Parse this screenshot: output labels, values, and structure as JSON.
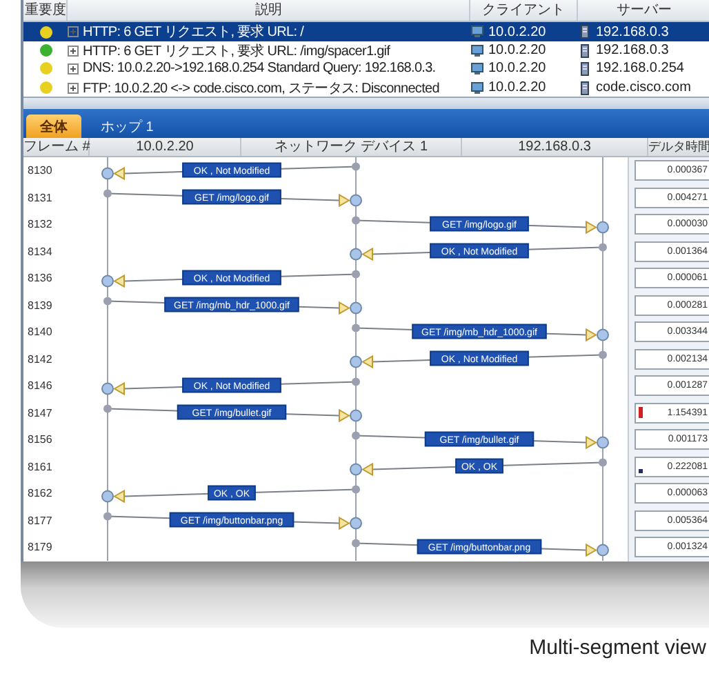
{
  "event_table": {
    "columns": [
      "重要度",
      "説明",
      "クライアント",
      "サーバー"
    ],
    "rows": [
      {
        "color": "#e8d020",
        "selected": true,
        "description": "HTTP: 6 GET リクエスト, 要求 URL: /",
        "client": "10.0.2.20",
        "server": "192.168.0.3"
      },
      {
        "color": "#3cb030",
        "selected": false,
        "description": "HTTP: 6 GET リクエスト, 要求 URL: /img/spacer1.gif",
        "client": "10.0.2.20",
        "server": "192.168.0.3"
      },
      {
        "color": "#e8d020",
        "selected": false,
        "description": "DNS: 10.0.2.20->192.168.0.254 Standard Query: 192.168.0.3.",
        "client": "10.0.2.20",
        "server": "192.168.0.254"
      },
      {
        "color": "#e8d020",
        "selected": false,
        "description": "FTP: 10.0.2.20 <-> code.cisco.com, ステータス: Disconnected",
        "client": "10.0.2.20",
        "server": "code.cisco.com"
      }
    ]
  },
  "tabs": [
    {
      "label": "全体",
      "selected": true
    },
    {
      "label": "ホップ 1",
      "selected": false
    }
  ],
  "flow": {
    "columns": [
      "フレーム #",
      "10.0.2.20",
      "ネットワーク デバイス 1",
      "192.168.0.3",
      "デルタ時間"
    ],
    "rows": [
      {
        "frame": "8130",
        "kind": "clientresp",
        "message": "OK , Not Modified",
        "delta": "0.000367",
        "flagged": false,
        "marked": false
      },
      {
        "frame": "8131",
        "kind": "clientreq",
        "message": "GET /img/logo.gif",
        "delta": "0.004271",
        "flagged": false,
        "marked": false
      },
      {
        "frame": "8132",
        "kind": "serverreq",
        "message": "GET /img/logo.gif",
        "delta": "0.000030",
        "flagged": false,
        "marked": false
      },
      {
        "frame": "8134",
        "kind": "serverresp",
        "message": "OK , Not Modified",
        "delta": "0.001364",
        "flagged": false,
        "marked": false
      },
      {
        "frame": "8136",
        "kind": "clientresp",
        "message": "OK , Not Modified",
        "delta": "0.000061",
        "flagged": false,
        "marked": false
      },
      {
        "frame": "8139",
        "kind": "clientreq",
        "message": "GET /img/mb_hdr_1000.gif",
        "delta": "0.000281",
        "flagged": false,
        "marked": false
      },
      {
        "frame": "8140",
        "kind": "serverreq",
        "message": "GET /img/mb_hdr_1000.gif",
        "delta": "0.003344",
        "flagged": false,
        "marked": false
      },
      {
        "frame": "8142",
        "kind": "serverresp",
        "message": "OK , Not Modified",
        "delta": "0.002134",
        "flagged": false,
        "marked": false
      },
      {
        "frame": "8146",
        "kind": "clientresp",
        "message": "OK , Not Modified",
        "delta": "0.001287",
        "flagged": false,
        "marked": false
      },
      {
        "frame": "8147",
        "kind": "clientreq",
        "message": "GET /img/bullet.gif",
        "delta": "1.154391",
        "flagged": true,
        "marked": false
      },
      {
        "frame": "8156",
        "kind": "serverreq",
        "message": "GET /img/bullet.gif",
        "delta": "0.001173",
        "flagged": false,
        "marked": false
      },
      {
        "frame": "8161",
        "kind": "serverresp",
        "message": "OK , OK",
        "delta": "0.222081",
        "flagged": false,
        "marked": true
      },
      {
        "frame": "8162",
        "kind": "clientresp",
        "message": "OK , OK",
        "delta": "0.000063",
        "flagged": false,
        "marked": false
      },
      {
        "frame": "8177",
        "kind": "clientreq",
        "message": "GET /img/buttonbar.png",
        "delta": "0.005364",
        "flagged": false,
        "marked": false
      },
      {
        "frame": "8179",
        "kind": "serverreq",
        "message": "GET /img/buttonbar.png",
        "delta": "0.001324",
        "flagged": false,
        "marked": false
      }
    ]
  },
  "caption": "Multi-segment view"
}
